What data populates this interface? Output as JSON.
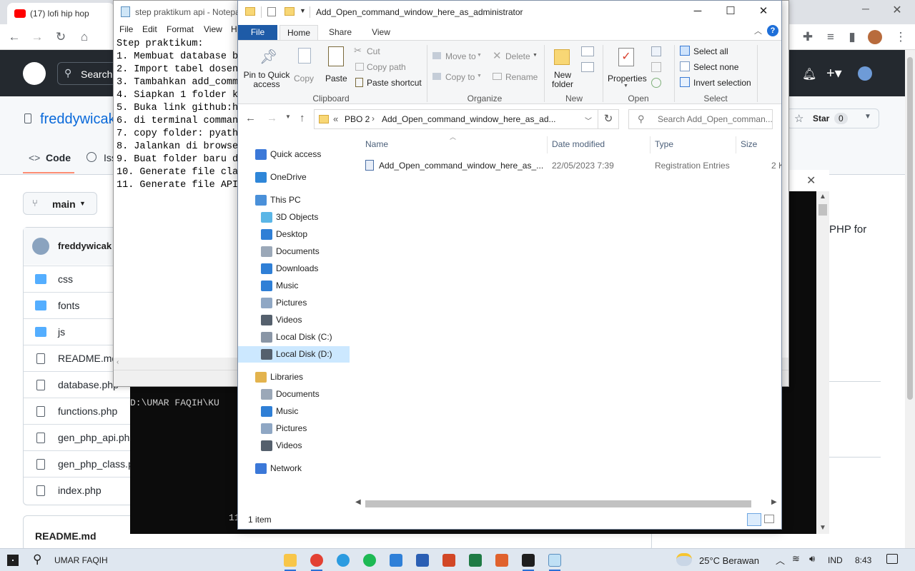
{
  "browser": {
    "tab_title": "(17) lofi hip hop",
    "search_label": "Search",
    "repo_owner": "freddywicak",
    "code_tab": "Code",
    "issues_tab": "Iss",
    "branch": "main",
    "star_label": "Star",
    "star_count": "0",
    "commit_user": "freddywicak",
    "about_fragment": "PHP for",
    "files": [
      "css",
      "fonts",
      "js",
      "README.md",
      "database.php",
      "functions.php",
      "gen_php_api.php",
      "gen_php_class.p",
      "index.php"
    ],
    "readme_heading": "README.md"
  },
  "terminal": {
    "prompt_line": "D:\\UMAR FAQIH\\KU",
    "partial_line": "11"
  },
  "notepad": {
    "title": "step praktikum api - Notepa",
    "menu": [
      "File",
      "Edit",
      "Format",
      "View",
      "H"
    ],
    "lines": [
      "Step praktikum:",
      "1. Membuat database b",
      "2. Import tabel dosen",
      "3. Tambahkan add_comm",
      "4. Siapkan 1 folder k",
      "5. Buka link github:h",
      "6. di terminal comman",
      "7. copy folder: pyath",
      "8. Jalankan di browse",
      "9. Buat folder baru d",
      "10. Generate file cla",
      "11. Generate file API"
    ]
  },
  "explorer": {
    "title": "Add_Open_command_window_here_as_administrator",
    "ribbon_tabs": [
      "File",
      "Home",
      "Share",
      "View"
    ],
    "clipboard": {
      "pin": "Pin to Quick access",
      "copy": "Copy",
      "paste": "Paste",
      "cut": "Cut",
      "copy_path": "Copy path",
      "paste_shortcut": "Paste shortcut",
      "group": "Clipboard"
    },
    "organize": {
      "move_to": "Move to",
      "copy_to": "Copy to",
      "delete": "Delete",
      "rename": "Rename",
      "group": "Organize"
    },
    "new": {
      "new_folder": "New folder",
      "group": "New"
    },
    "open": {
      "properties": "Properties",
      "group": "Open"
    },
    "select": {
      "select_all": "Select all",
      "select_none": "Select none",
      "invert": "Invert selection",
      "group": "Select"
    },
    "address": {
      "prefix": "«",
      "crumb1": "PBO 2",
      "crumb2": "Add_Open_command_window_here_as_ad..."
    },
    "search_placeholder": "Search Add_Open_comman...",
    "nav": {
      "quick_access": "Quick access",
      "onedrive": "OneDrive",
      "this_pc": "This PC",
      "objects3d": "3D Objects",
      "desktop": "Desktop",
      "documents": "Documents",
      "downloads": "Downloads",
      "music": "Music",
      "pictures": "Pictures",
      "videos": "Videos",
      "local_c": "Local Disk (C:)",
      "local_d": "Local Disk (D:)",
      "libraries": "Libraries",
      "lib_documents": "Documents",
      "lib_music": "Music",
      "lib_pictures": "Pictures",
      "lib_videos": "Videos",
      "network": "Network"
    },
    "columns": {
      "name": "Name",
      "date": "Date modified",
      "type": "Type",
      "size": "Size"
    },
    "file": {
      "name": "Add_Open_command_window_here_as_...",
      "date": "22/05/2023 7:39",
      "type": "Registration Entries",
      "size": "2 K"
    },
    "status": "1 item"
  },
  "taskbar": {
    "user": "UMAR FAQIH",
    "weather": "25°C  Berawan",
    "lang": "IND",
    "time": "8:43"
  },
  "colors": {
    "ribbon_file_tab": "#1e5ba7",
    "selected_nav": "#cce8ff",
    "github_header": "#24292f"
  }
}
